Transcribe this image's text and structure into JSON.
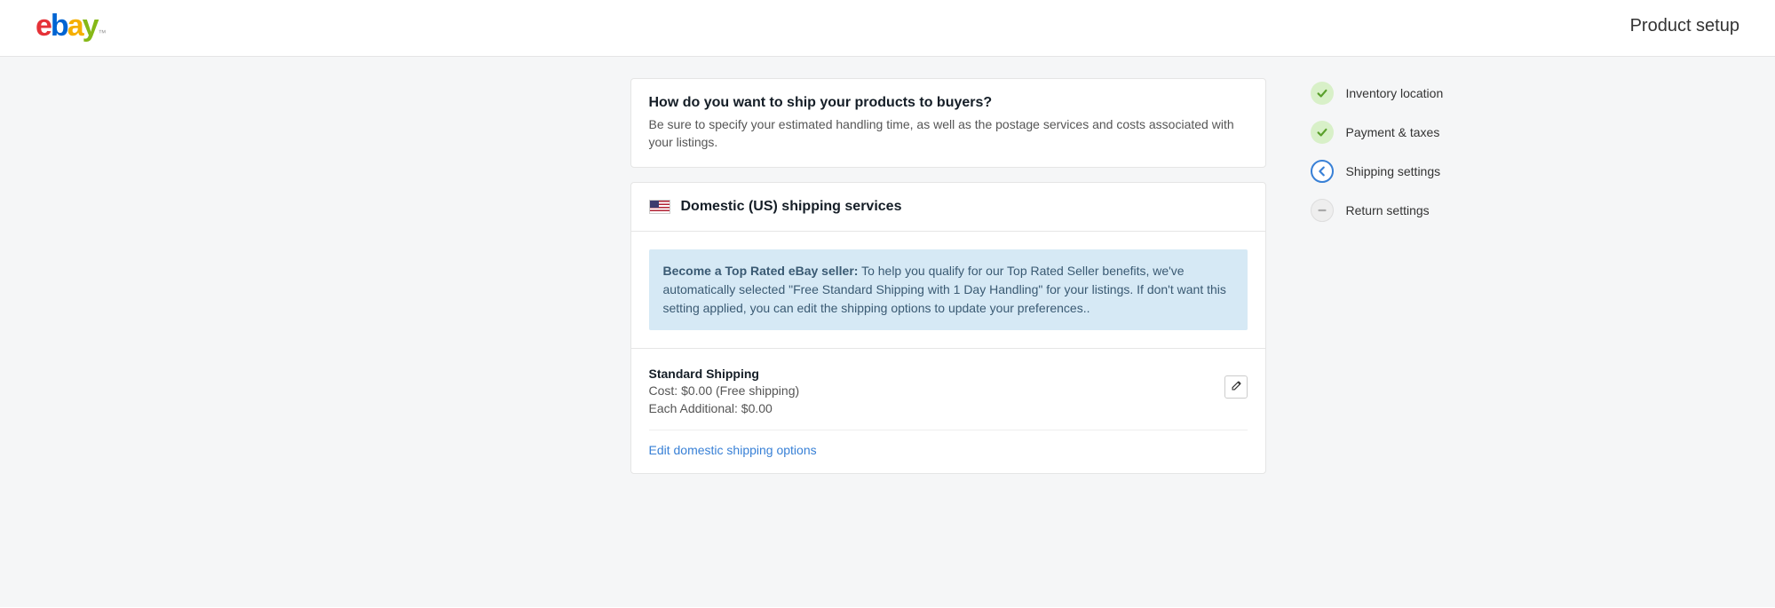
{
  "header": {
    "logo_text": "ebay",
    "page_title": "Product setup"
  },
  "intro": {
    "heading": "How do you want to ship your products to buyers?",
    "sub": "Be sure to specify your estimated handling time, as well as the postage services and costs associated with your listings."
  },
  "domestic": {
    "title": "Domestic (US) shipping services",
    "banner_strong": "Become a Top Rated eBay seller:",
    "banner_text": " To help you qualify for our Top Rated Seller benefits, we've automatically selected \"Free Standard Shipping with 1 Day Handling\" for your listings. If don't want this setting applied, you can edit the shipping options to update your preferences..",
    "service": {
      "name": "Standard Shipping",
      "cost": "Cost: $0.00 (Free shipping)",
      "additional": "Each Additional: $0.00"
    },
    "edit_link": "Edit domestic shipping options"
  },
  "steps": [
    {
      "label": "Inventory location",
      "state": "done"
    },
    {
      "label": "Payment & taxes",
      "state": "done"
    },
    {
      "label": "Shipping settings",
      "state": "current"
    },
    {
      "label": "Return settings",
      "state": "pending"
    }
  ]
}
